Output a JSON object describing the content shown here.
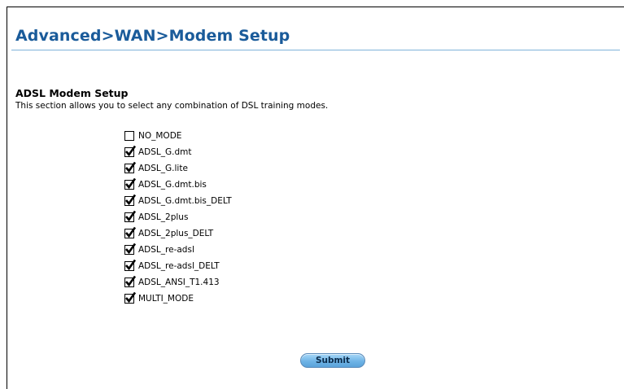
{
  "page": {
    "title": "Advanced>WAN>Modem Setup"
  },
  "section": {
    "title": "ADSL Modem Setup",
    "description": "This section allows you to select any combination of DSL training modes."
  },
  "modes": [
    {
      "label": "NO_MODE",
      "checked": false
    },
    {
      "label": "ADSL_G.dmt",
      "checked": true
    },
    {
      "label": "ADSL_G.lite",
      "checked": true
    },
    {
      "label": "ADSL_G.dmt.bis",
      "checked": true
    },
    {
      "label": "ADSL_G.dmt.bis_DELT",
      "checked": true
    },
    {
      "label": "ADSL_2plus",
      "checked": true
    },
    {
      "label": "ADSL_2plus_DELT",
      "checked": true
    },
    {
      "label": "ADSL_re-adsl",
      "checked": true
    },
    {
      "label": "ADSL_re-adsl_DELT",
      "checked": true
    },
    {
      "label": "ADSL_ANSI_T1.413",
      "checked": true
    },
    {
      "label": "MULTI_MODE",
      "checked": true
    }
  ],
  "buttons": {
    "submit_label": "Submit"
  },
  "colors": {
    "title": "#1a5b9a",
    "rule": "#7fb3d9",
    "button": "#6fb4e6"
  }
}
